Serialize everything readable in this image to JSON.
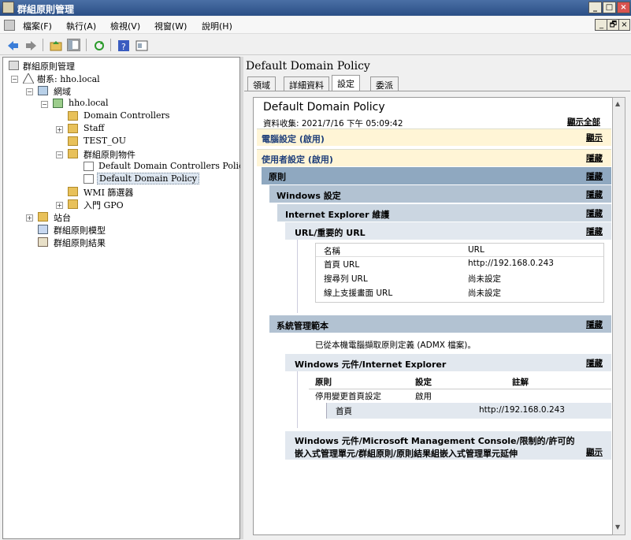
{
  "window": {
    "title": "群組原則管理",
    "min": "_",
    "max": "□",
    "close": "×"
  },
  "menu": [
    "檔案(F)",
    "執行(A)",
    "檢視(V)",
    "視窗(W)",
    "說明(H)"
  ],
  "inner_window": {
    "min": "_",
    "restore": "🗗",
    "close": "×"
  },
  "tree": {
    "root": "群組原則管理",
    "forest": "樹系: hho.local",
    "domains": "網域",
    "domain": "hho.local",
    "dc": "Domain Controllers",
    "staff": "Staff",
    "test": "TEST_OU",
    "gpo_objects": "群組原則物件",
    "gpo_dc": "Default Domain Controllers Policy",
    "gpo_dd": "Default Domain Policy",
    "wmi": "WMI 篩選器",
    "starter": "入門 GPO",
    "sites": "站台",
    "modeling": "群組原則模型",
    "results": "群組原則結果"
  },
  "right": {
    "title": "Default Domain Policy",
    "tabs": [
      "領域",
      "詳細資料",
      "設定",
      "委派"
    ],
    "report_title": "Default Domain Policy",
    "collected": "資料收集: 2021/7/16 下午 05:09:42",
    "show_all": "顯示全部",
    "computer": "電腦設定 (啟用)",
    "computer_link": "顯示",
    "user": "使用者設定 (啟用)",
    "user_link": "隱藏",
    "policies": "原則",
    "policies_link": "隱藏",
    "win_settings": "Windows 設定",
    "win_link": "隱藏",
    "ie_maint": "Internet Explorer 維護",
    "ie_link": "隱藏",
    "url": "URL/重要的 URL",
    "url_link": "隱藏",
    "url_table": {
      "headers": [
        "名稱",
        "URL"
      ],
      "rows": [
        [
          "首頁 URL",
          "http://192.168.0.243"
        ],
        [
          "搜尋列 URL",
          "尚未設定"
        ],
        [
          "線上支援畫面 URL",
          "尚未設定"
        ]
      ]
    },
    "admin_templates": "系統管理範本",
    "admin_link": "隱藏",
    "admx_note": "已從本機電腦擷取原則定義 (ADMX 檔案)。",
    "wc_ie": "Windows 元件/Internet Explorer",
    "wc_ie_link": "隱藏",
    "policy_table": {
      "headers": [
        "原則",
        "設定",
        "註解"
      ],
      "row": [
        "停用變更首頁設定",
        "啟用"
      ],
      "sub": [
        "首頁",
        "http://192.168.0.243"
      ]
    },
    "mmc_line1": "Windows 元件/Microsoft Management Console/限制的/許可的",
    "mmc_line2": "嵌入式管理單元/群組原則/原則結果組嵌入式管理單元延伸",
    "mmc_link": "顯示"
  },
  "colors": {
    "titlebar": "#2b4f86",
    "computer_bg": "#fff5d6",
    "user_bg": "#fff5d6",
    "policies_bg": "#8fa8c0",
    "win_bg": "#b2c2d2",
    "ie_bg": "#cbd6e1",
    "url_bg": "#e2e8ef"
  }
}
